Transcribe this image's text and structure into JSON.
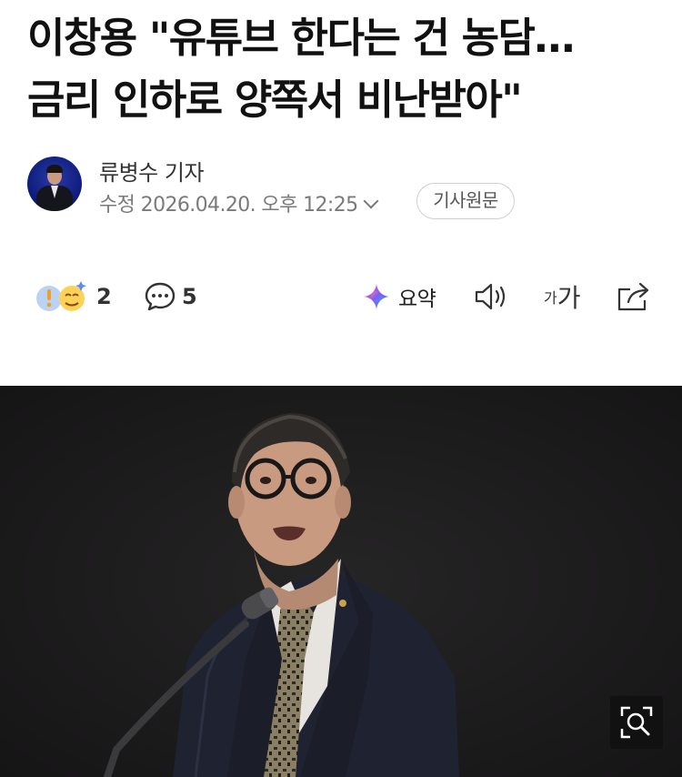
{
  "article": {
    "headline_line1": "이창용 \"유튜브 한다는 건 농담…",
    "headline_line2": "금리 인하로 양쪽서 비난받아\""
  },
  "byline": {
    "reporter": "류병수 기자",
    "meta": "수정 2026.04.20. 오후 12:25",
    "original_label": "기사원문"
  },
  "toolbar": {
    "reaction_count": "2",
    "comment_count": "5",
    "summary_label": "요약",
    "font_small": "가",
    "font_big": "가"
  },
  "colors": {
    "photo_background": "#1c1b1c",
    "summary_accent": "#6a5cf0",
    "meta_text": "#7a7a7a"
  },
  "icons": [
    "reaction-emoji-icon",
    "comment-icon",
    "ai-summary-icon",
    "speaker-icon",
    "share-icon",
    "zoom-icon"
  ]
}
